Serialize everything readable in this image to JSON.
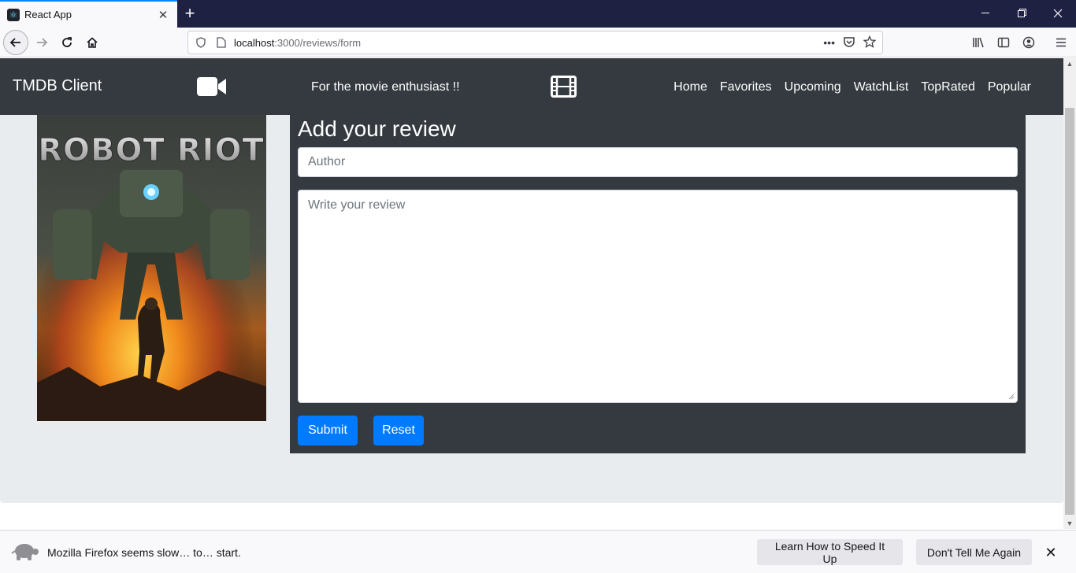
{
  "browser": {
    "tab_title": "React App",
    "new_tab_symbol": "+",
    "url_host": "localhost",
    "url_path": ":3000/reviews/form",
    "icons": {
      "favicon": "react-logo-icon",
      "tab_close": "close-icon",
      "back": "arrow-left-icon",
      "forward": "arrow-right-icon",
      "reload": "reload-icon",
      "home": "home-icon",
      "shield": "shield-icon",
      "page": "page-icon",
      "more": "ellipsis-icon",
      "pocket": "pocket-icon",
      "bookmark": "star-icon",
      "library": "library-icon",
      "sidebar": "sidebar-icon",
      "account": "account-icon",
      "menu": "hamburger-menu-icon"
    }
  },
  "app": {
    "brand": "TMDB Client",
    "tagline": "For the movie enthusiast !!",
    "nav_links": [
      "Home",
      "Favorites",
      "Upcoming",
      "WatchList",
      "TopRated",
      "Popular"
    ],
    "icons": {
      "left": "video-camera-icon",
      "right": "film-icon"
    },
    "colors": {
      "navbar": "#343a40",
      "page_bg": "#e9ecef",
      "primary": "#007bff"
    }
  },
  "poster": {
    "title_text": "ROBOT RIOT"
  },
  "form": {
    "title": "Add your review",
    "author_placeholder": "Author",
    "review_placeholder": "Write your review",
    "submit_label": "Submit",
    "reset_label": "Reset"
  },
  "notification": {
    "message": "Mozilla Firefox seems slow… to… start.",
    "learn_label": "Learn How to Speed It Up",
    "dont_label": "Don't Tell Me Again",
    "icon": "turtle-icon"
  }
}
